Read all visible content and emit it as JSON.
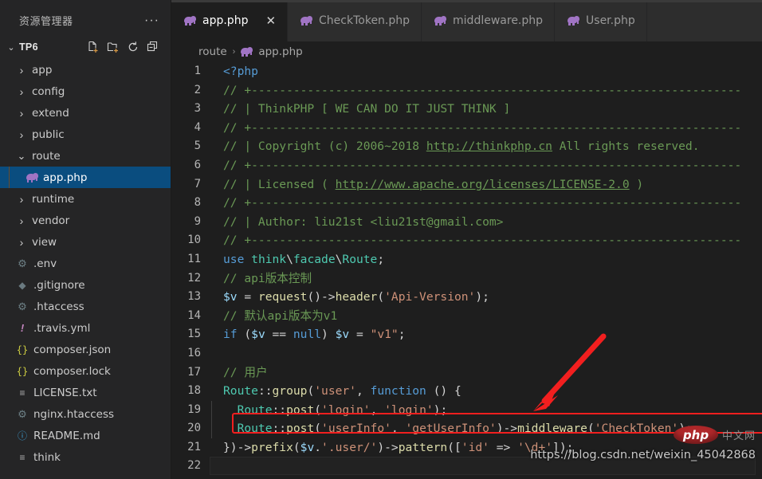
{
  "sidebar": {
    "title": "资源管理器",
    "more_label": "···",
    "root": {
      "label": "TP6",
      "twisty": "⌄"
    },
    "actions": [
      {
        "name": "new-file-icon",
        "label": "New File"
      },
      {
        "name": "new-folder-icon",
        "label": "New Folder"
      },
      {
        "name": "refresh-icon",
        "label": "Refresh Explorer"
      },
      {
        "name": "collapse-all-icon",
        "label": "Collapse Folders in Explorer"
      }
    ],
    "items": [
      {
        "label": "app",
        "type": "folder",
        "expanded": false,
        "indent": 2,
        "icon": "chevron-right-icon",
        "selected": false
      },
      {
        "label": "config",
        "type": "folder",
        "expanded": false,
        "indent": 2,
        "icon": "chevron-right-icon",
        "selected": false
      },
      {
        "label": "extend",
        "type": "folder",
        "expanded": false,
        "indent": 2,
        "icon": "chevron-right-icon",
        "selected": false
      },
      {
        "label": "public",
        "type": "folder",
        "expanded": false,
        "indent": 2,
        "icon": "chevron-right-icon",
        "selected": false
      },
      {
        "label": "route",
        "type": "folder",
        "expanded": true,
        "indent": 2,
        "icon": "chevron-down-icon",
        "selected": false
      },
      {
        "label": "app.php",
        "type": "file",
        "indent": 3,
        "icon": "php-file-icon",
        "selected": true
      },
      {
        "label": "runtime",
        "type": "folder",
        "expanded": false,
        "indent": 2,
        "icon": "chevron-right-icon",
        "selected": false
      },
      {
        "label": "vendor",
        "type": "folder",
        "expanded": false,
        "indent": 2,
        "icon": "chevron-right-icon",
        "selected": false
      },
      {
        "label": "view",
        "type": "folder",
        "expanded": false,
        "indent": 2,
        "icon": "chevron-right-icon",
        "selected": false
      },
      {
        "label": ".env",
        "type": "file",
        "indent": 2,
        "icon": "gear-icon",
        "selected": false
      },
      {
        "label": ".gitignore",
        "type": "file",
        "indent": 2,
        "icon": "git-icon",
        "selected": false
      },
      {
        "label": ".htaccess",
        "type": "file",
        "indent": 2,
        "icon": "gear-icon",
        "selected": false
      },
      {
        "label": ".travis.yml",
        "type": "file",
        "indent": 2,
        "icon": "exclaim-icon",
        "selected": false
      },
      {
        "label": "composer.json",
        "type": "file",
        "indent": 2,
        "icon": "braces-icon",
        "selected": false
      },
      {
        "label": "composer.lock",
        "type": "file",
        "indent": 2,
        "icon": "braces-icon",
        "selected": false
      },
      {
        "label": "LICENSE.txt",
        "type": "file",
        "indent": 2,
        "icon": "lines-icon",
        "selected": false
      },
      {
        "label": "nginx.htaccess",
        "type": "file",
        "indent": 2,
        "icon": "gear-icon",
        "selected": false
      },
      {
        "label": "README.md",
        "type": "file",
        "indent": 2,
        "icon": "info-icon",
        "selected": false
      },
      {
        "label": "think",
        "type": "file",
        "indent": 2,
        "icon": "lines-icon",
        "selected": false
      }
    ]
  },
  "tabs": [
    {
      "label": "app.php",
      "icon": "php-file-icon",
      "active": true,
      "close": "✕"
    },
    {
      "label": "CheckToken.php",
      "icon": "php-file-icon",
      "active": false
    },
    {
      "label": "middleware.php",
      "icon": "php-file-icon",
      "active": false
    },
    {
      "label": "User.php",
      "icon": "php-file-icon",
      "active": false
    }
  ],
  "breadcrumb": {
    "folder": "route",
    "separator": "›",
    "file": "app.php"
  },
  "editor": {
    "language": "php",
    "current_line": 22,
    "lines": [
      {
        "n": 1,
        "text": "<?php"
      },
      {
        "n": 2,
        "text": "// +----------------------------------------------------------------------"
      },
      {
        "n": 3,
        "text": "// | ThinkPHP [ WE CAN DO IT JUST THINK ]"
      },
      {
        "n": 4,
        "text": "// +----------------------------------------------------------------------"
      },
      {
        "n": 5,
        "text": "// | Copyright (c) 2006~2018 http://thinkphp.cn All rights reserved."
      },
      {
        "n": 6,
        "text": "// +----------------------------------------------------------------------"
      },
      {
        "n": 7,
        "text": "// | Licensed ( http://www.apache.org/licenses/LICENSE-2.0 )"
      },
      {
        "n": 8,
        "text": "// +----------------------------------------------------------------------"
      },
      {
        "n": 9,
        "text": "// | Author: liu21st <liu21st@gmail.com>"
      },
      {
        "n": 10,
        "text": "// +----------------------------------------------------------------------"
      },
      {
        "n": 11,
        "text": "use think\\facade\\Route;"
      },
      {
        "n": 12,
        "text": "// api版本控制"
      },
      {
        "n": 13,
        "text": "$v = request()->header('Api-Version');"
      },
      {
        "n": 14,
        "text": "// 默认api版本为v1"
      },
      {
        "n": 15,
        "text": "if ($v == null) $v = \"v1\";"
      },
      {
        "n": 16,
        "text": ""
      },
      {
        "n": 17,
        "text": "// 用户"
      },
      {
        "n": 18,
        "text": "Route::group('user', function () {"
      },
      {
        "n": 19,
        "text": "  Route::post('login', 'login');"
      },
      {
        "n": 20,
        "text": "  Route::post('userInfo', 'getUserInfo')->middleware('CheckToken');"
      },
      {
        "n": 21,
        "text": "})->prefix($v.'.user/')->pattern(['id' => '\\d+']);"
      },
      {
        "n": 22,
        "text": ""
      }
    ]
  },
  "annotations": {
    "highlight_box": {
      "target_line": 20,
      "color": "#f21f1f"
    },
    "arrow": {
      "color": "#f21f1f",
      "from": "upper-right",
      "to": "line-20"
    }
  },
  "watermark": {
    "url": "https://blog.csdn.net/weixin_45042868",
    "logo_text": "php",
    "logo_suffix": "中文网",
    "logo_color": "#b0282a"
  }
}
